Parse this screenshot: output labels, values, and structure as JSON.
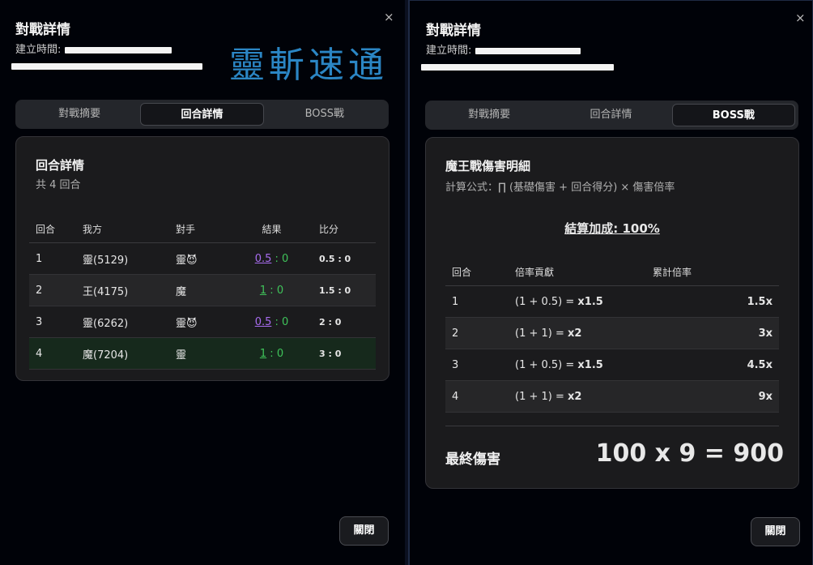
{
  "left": {
    "title": "對戰詳情",
    "created_label": "建立時間:",
    "close_symbol": "×",
    "watermark": "靈斬速通",
    "tabs": [
      "對戰摘要",
      "回合詳情",
      "BOSS戰"
    ],
    "active_tab": "回合詳情",
    "card": {
      "title": "回合詳情",
      "subtitle": "共 4 回合",
      "headers": [
        "回合",
        "我方",
        "對手",
        "結果",
        "比分"
      ],
      "rows": [
        {
          "round": "1",
          "self": "靈(5129)",
          "opp": "靈😈",
          "res_l": "0.5",
          "res_r": "0",
          "score": "0.5 : 0"
        },
        {
          "round": "2",
          "self": "王(4175)",
          "opp": "魔",
          "res_l": "1",
          "res_r": "0",
          "score": "1.5 : 0"
        },
        {
          "round": "3",
          "self": "靈(6262)",
          "opp": "靈😈",
          "res_l": "0.5",
          "res_r": "0",
          "score": "2 : 0"
        },
        {
          "round": "4",
          "self": "魔(7204)",
          "opp": "靈",
          "res_l": "1",
          "res_r": "0",
          "score": "3 : 0"
        }
      ]
    },
    "close_button": "關閉"
  },
  "right": {
    "title": "對戰詳情",
    "created_label": "建立時間:",
    "close_symbol": "×",
    "tabs": [
      "對戰摘要",
      "回合詳情",
      "BOSS戰"
    ],
    "active_tab": "BOSS戰",
    "card": {
      "title": "魔王戰傷害明細",
      "formula": "計算公式：∏ (基礎傷害 + 回合得分) × 傷害倍率",
      "bonus": "結算加成: 100%",
      "headers": [
        "回合",
        "倍率貢獻",
        "累計倍率"
      ],
      "rows": [
        {
          "round": "1",
          "expr": "(1 + 0.5) = ",
          "mult": "x1.5",
          "cum": "1.5x"
        },
        {
          "round": "2",
          "expr": "(1 + 1) = ",
          "mult": "x2",
          "cum": "3x"
        },
        {
          "round": "3",
          "expr": "(1 + 0.5) = ",
          "mult": "x1.5",
          "cum": "4.5x"
        },
        {
          "round": "4",
          "expr": "(1 + 1) = ",
          "mult": "x2",
          "cum": "9x"
        }
      ],
      "final_label": "最終傷害",
      "final_value": "100 x 9 = 900"
    },
    "close_button": "關閉"
  }
}
